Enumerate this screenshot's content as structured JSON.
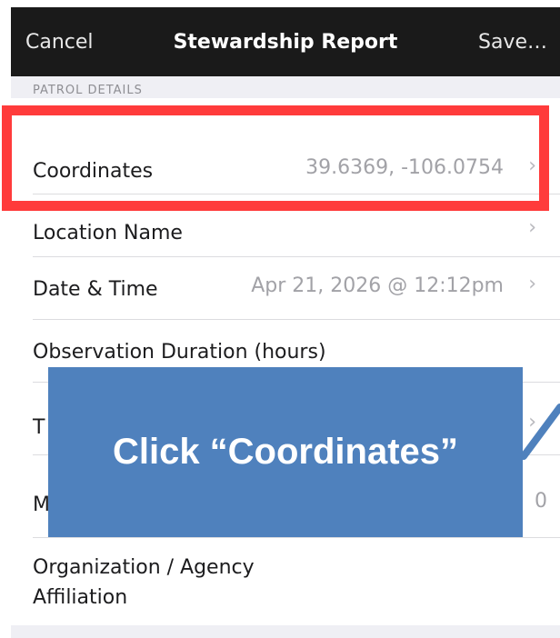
{
  "nav": {
    "cancel": "Cancel",
    "title": "Stewardship Report",
    "save": "Save…"
  },
  "section": {
    "header": "PATROL DETAILS"
  },
  "rows": [
    {
      "label": "Coordinates",
      "value": "39.6369, -106.0754",
      "chevron": "›"
    },
    {
      "label": "Location Name",
      "value": "",
      "chevron": "›"
    },
    {
      "label": "Date & Time",
      "value": "Apr 21, 2026 @ 12:12pm",
      "chevron": "›"
    },
    {
      "label": "Observation Duration (hours)",
      "value": ""
    },
    {
      "label": "T",
      "value": "",
      "chevron": "›"
    },
    {
      "label": "M",
      "value": "0"
    },
    {
      "label": "Organization / Agency Affiliation",
      "value": ""
    }
  ],
  "callout": {
    "text": "Click “Coordinates”"
  },
  "colors": {
    "navbar": "#1a1a1a",
    "highlight": "#ff3b3b",
    "callout": "#4f81bd"
  }
}
